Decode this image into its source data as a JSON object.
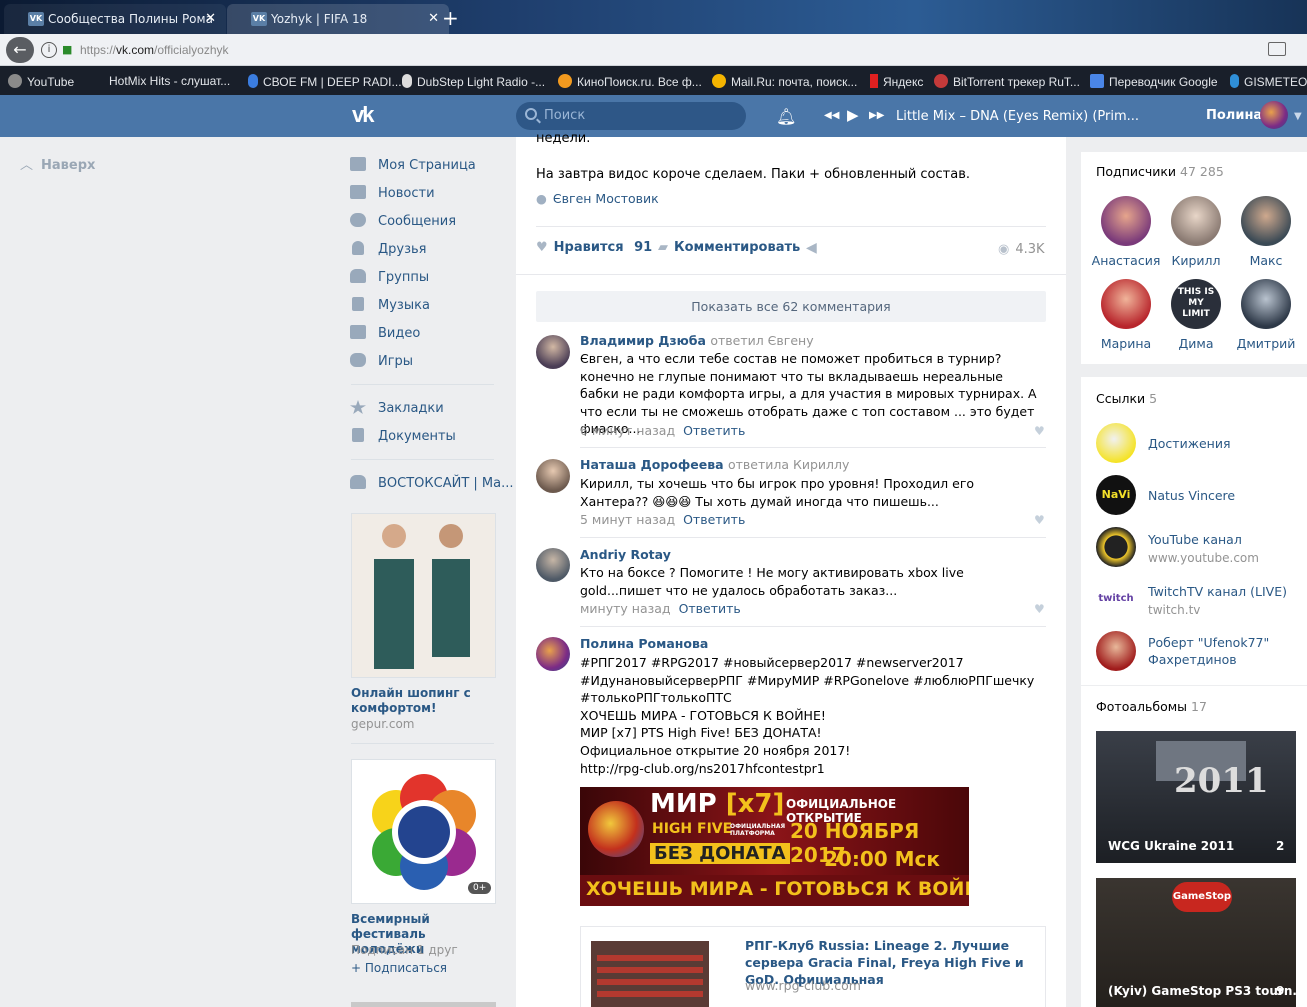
{
  "browser": {
    "tabs": [
      {
        "title": "Сообщества Полины Рома"
      },
      {
        "title": "Yozhyk | FIFA 18"
      }
    ],
    "url_scheme": "https://",
    "url_host": "vk.com",
    "url_path": "/officialyozhyk",
    "bookmarks": [
      "YouTube",
      "HotMix Hits - слушат...",
      "СВОЕ FM | DEEP RADI...",
      "DubStep Light Radio -...",
      "КиноПоиск.ru. Все ф...",
      "Mail.Ru: почта, поиск...",
      "Яндекс",
      "BitTorrent трекер RuT...",
      "Переводчик Google",
      "GISMETEO"
    ]
  },
  "header": {
    "logo": "vk",
    "search_placeholder": "Поиск",
    "track": "Little Mix – DNA (Eyes Remix) (Prim...",
    "user_name": "Полина"
  },
  "left": {
    "back_to_top": "Наверх",
    "menu": [
      "Моя Страница",
      "Новости",
      "Сообщения",
      "Друзья",
      "Группы",
      "Музыка",
      "Видео",
      "Игры"
    ],
    "menu2": [
      "Закладки",
      "Документы"
    ],
    "group": "ВОСТОКСАЙТ | Ма...",
    "ad1": {
      "title": "Онлайн шопинг с комфортом!",
      "site": "gepur.com"
    },
    "ad2": {
      "title": "Всемирный фестиваль молодёжи",
      "sub": "Подписан 1 друг",
      "action": "+ Подписаться",
      "badge": "0+"
    }
  },
  "post": {
    "text_top": "недели.",
    "text": "На завтра видос короче сделаем. Паки + обновленный состав.",
    "author": "Євген Мостовик",
    "like_label": "Нравится",
    "likes": "91",
    "comment_label": "Комментировать",
    "views": "4.3K",
    "show_all": "Показать все 62 комментария"
  },
  "comments": [
    {
      "name": "Владимир Дзюба",
      "note": "ответил Євгену",
      "text": "Євген, а что если тебе состав не поможет пробиться в турнир? конечно не глупые понимают что ты вкладываешь нереальные бабки не ради комфорта игры, а для участия в мировых турнирах. А что если ты не сможешь отобрать даже с топ составом ... это будет фиаско...",
      "time": "6 минут назад",
      "reply": "Ответить"
    },
    {
      "name": "Наташа Дорофеева",
      "note": "ответила Кириллу",
      "text": "Кирилл, ты хочешь что бы игрок про уровня! Проходил его Хантера?? 😆😆😆 Ты хоть думай иногда что пишешь...",
      "time": "5 минут назад",
      "reply": "Ответить"
    },
    {
      "name": "Andriy Rotay",
      "note": "",
      "text": "Кто на боксе ? Помогите ! Не могу активировать xbox live gold...пишет что не удалось обработать заказ...",
      "time": "минуту назад",
      "reply": "Ответить"
    },
    {
      "name": "Полина Романова",
      "note": "",
      "hashtags": "#РПГ2017 #RPG2017 #новыйсервер2017 #newserver2017 #ИдунановыйсерверРПГ #МируМИР #RPGonelove #люблюРПГшечку #толькоРПГтолькоПТС",
      "lines": [
        "ХОЧЕШЬ МИРА - ГОТОВЬСЯ К ВОЙНЕ!",
        "МИР [x7] PTS High Five! БЕЗ ДОНАТА!",
        "Официальное открытие 20 ноября 2017!"
      ],
      "link": "http://rpg-club.org/ns2017hfcontestpr1"
    }
  ],
  "banner": {
    "l1": "МИР",
    "l1b": "[x7]",
    "l2": "HIGH FIVE",
    "l2s": "ОФИЦИАЛЬНАЯ ПЛАТФОРМА",
    "l3": "БЕЗ ДОНАТА",
    "r1": "ОФИЦИАЛЬНОЕ ОТКРЫТИЕ",
    "r2": "20 НОЯБРЯ 2017",
    "r3": "20:00 Мск",
    "bottom": "ХОЧЕШЬ МИРА - ГОТОВЬСЯ К ВОЙНЕ"
  },
  "link_card": {
    "title": "РПГ-Клуб Russia: Lineage 2. Лучшие сервера Gracia Final, Freya High Five и GoD. Официальная",
    "site": "www.rpg-club.com"
  },
  "right": {
    "subs_label": "Подписчики",
    "subs_count": "47 285",
    "friends": [
      "Анастасия",
      "Кирилл",
      "Макс",
      "Марина",
      "Дима",
      "Дмитрий"
    ],
    "dima_overlay": "THIS IS MY LIMIT",
    "links_label": "Ссылки",
    "links_count": "5",
    "links": [
      {
        "name": "Достижения",
        "sub": ""
      },
      {
        "name": "Natus Vincere",
        "sub": ""
      },
      {
        "name": "YouTube канал",
        "sub": "www.youtube.com"
      },
      {
        "name": "TwitchTV канал (LIVE)",
        "sub": "twitch.tv"
      },
      {
        "name": "Роберт \"Ufenok77\" Фахретдинов",
        "sub": ""
      }
    ],
    "albums_label": "Фотоальбомы",
    "albums_count": "17",
    "albums": [
      {
        "name": "WCG Ukraine 2011",
        "count": "2"
      },
      {
        "name": "(Kyiv) GameStop PS3 tourn...",
        "count": "9"
      }
    ]
  }
}
